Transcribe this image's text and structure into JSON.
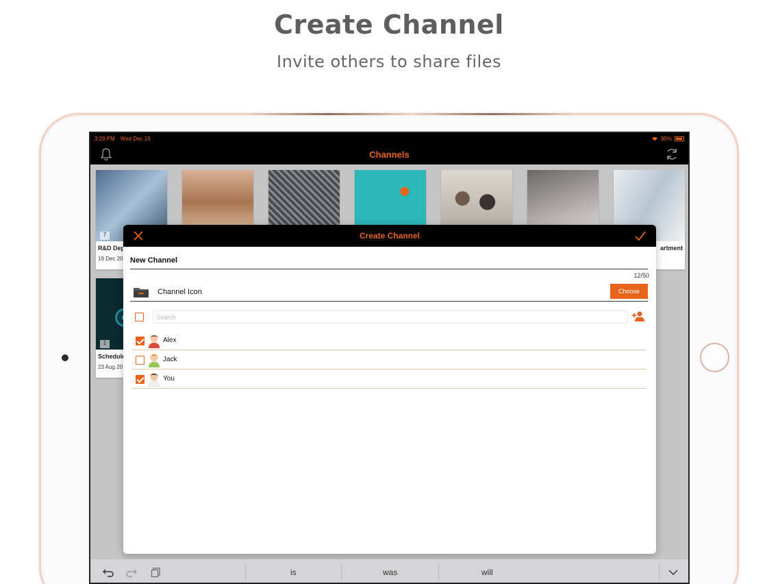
{
  "promo": {
    "title": "Create Channel",
    "subtitle": "Invite others to share files"
  },
  "status_bar": {
    "time": "3:29 PM",
    "date": "Wed Dec 19",
    "battery": "95%"
  },
  "navbar": {
    "title": "Channels",
    "left_icon": "bell-icon",
    "right_icon": "refresh-icon"
  },
  "channels": [
    {
      "name": "R&D Dep",
      "date": "19 Dec 20",
      "count": "7",
      "thumb_color": "#6f8aa6"
    },
    {
      "name": "",
      "date": "",
      "count": "",
      "thumb_color": "#c79a78"
    },
    {
      "name": "",
      "date": "",
      "count": "",
      "thumb_color": "#5e5e66"
    },
    {
      "name": "",
      "date": "",
      "count": "",
      "thumb_color": "#2bb6b8"
    },
    {
      "name": "",
      "date": "",
      "count": "",
      "thumb_color": "#b9b3a8"
    },
    {
      "name": "",
      "date": "",
      "count": "",
      "thumb_color": "#8e8a8a"
    },
    {
      "name": "artment",
      "date": "",
      "count": "",
      "thumb_color": "#c9d4dc"
    },
    {
      "name": "Schedule",
      "date": "23 Aug 20",
      "count": "1",
      "thumb_color": "#0d3a42"
    }
  ],
  "modal": {
    "title": "Create Channel",
    "channel_name": "New Channel",
    "char_count": "12/50",
    "icon_label": "Channel Icon",
    "choose_label": "Choose",
    "search_placeholder": "Search",
    "users": [
      {
        "name": "Alex",
        "checked": true
      },
      {
        "name": "Jack",
        "checked": false
      },
      {
        "name": "You",
        "checked": true
      }
    ]
  },
  "keyboard_bar": {
    "suggestions": [
      "is",
      "was",
      "will"
    ]
  },
  "colors": {
    "accent": "#e8641c",
    "header_bg": "#000000",
    "content_bg": "#c5c5c5"
  }
}
